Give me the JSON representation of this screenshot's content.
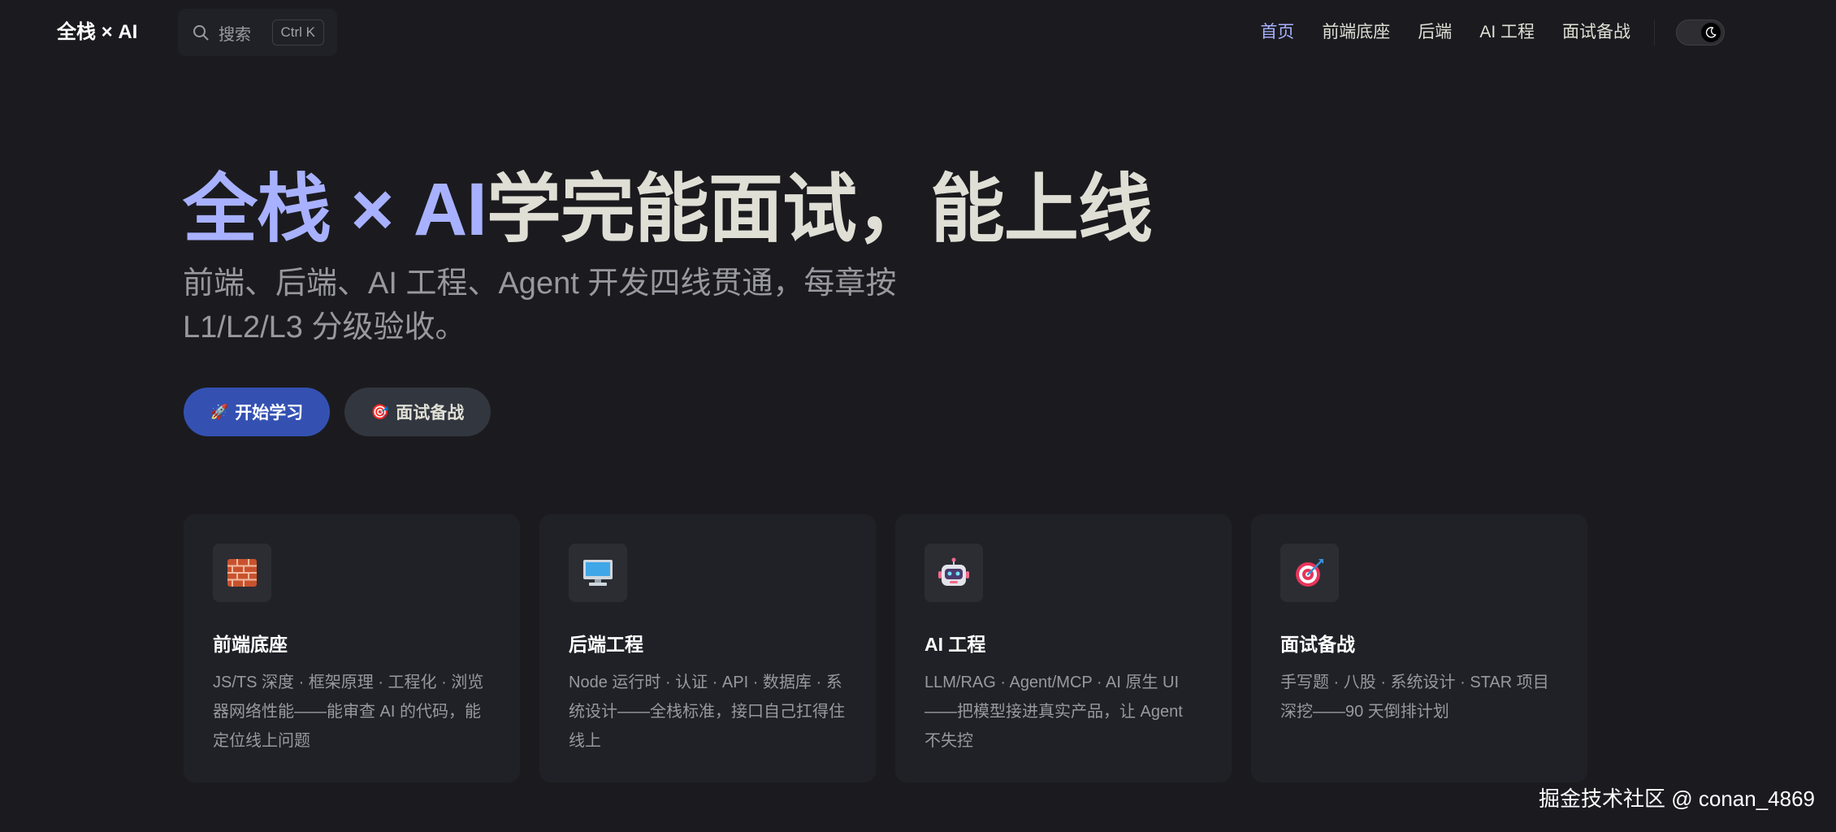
{
  "nav": {
    "brand": "全栈 × AI",
    "search_label": "搜索",
    "search_shortcut": "Ctrl K",
    "links": [
      {
        "label": "首页",
        "active": true
      },
      {
        "label": "前端底座",
        "active": false
      },
      {
        "label": "后端",
        "active": false
      },
      {
        "label": "AI 工程",
        "active": false
      },
      {
        "label": "面试备战",
        "active": false
      }
    ],
    "theme_icon": "moon-icon"
  },
  "hero": {
    "title_accent": "全栈 × AI",
    "title_rest": "学完能面试，能上线",
    "tagline": "前端、后端、AI 工程、Agent 开发四线贯通，每章按 L1/L2/L3 分级验收。",
    "actions": [
      {
        "icon": "🚀",
        "label": "开始学习"
      },
      {
        "icon": "🎯",
        "label": "面试备战"
      }
    ]
  },
  "features": [
    {
      "icon": "brick-icon",
      "title": "前端底座",
      "details": "JS/TS 深度 · 框架原理 · 工程化 · 浏览器网络性能——能审查 AI 的代码，能定位线上问题"
    },
    {
      "icon": "desktop-computer-icon",
      "title": "后端工程",
      "details": "Node 运行时 · 认证 · API · 数据库 · 系统设计——全栈标准，接口自己扛得住线上"
    },
    {
      "icon": "robot-icon",
      "title": "AI 工程",
      "details": "LLM/RAG · Agent/MCP · AI 原生 UI——把模型接进真实产品，让 Agent 不失控"
    },
    {
      "icon": "target-icon",
      "title": "面试备战",
      "details": "手写题 · 八股 · 系统设计 · STAR 项目深挖——90 天倒排计划"
    }
  ],
  "watermark": "掘金技术社区 @ conan_4869",
  "colors": {
    "background": "#1b1b1f",
    "card": "#202127",
    "accent": "#a8b1ff",
    "brand_button": "#3451b2",
    "alt_button": "#32363f",
    "muted_text": "#98989f"
  }
}
